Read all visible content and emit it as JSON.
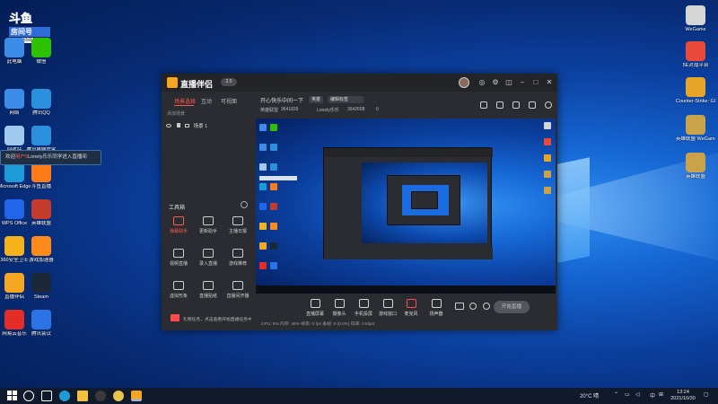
{
  "overlay": {
    "title": "斗鱼",
    "subtitle": "房间号",
    "room_no": "3642658"
  },
  "desktop_left": [
    {
      "label": "此电脑",
      "color": "#3b8de8"
    },
    {
      "label": "微信",
      "color": "#2dc100"
    },
    {
      "label": "网络",
      "color": "#3b8de8"
    },
    {
      "label": "腾讯QQ",
      "color": "#2a8fdd"
    },
    {
      "label": "回收站",
      "color": "#9fc9ef"
    },
    {
      "label": "腾讯电脑管家",
      "color": "#2a8fdd"
    },
    {
      "label": "Microsoft Edge",
      "color": "#1d9bd8"
    },
    {
      "label": "斗鱼直播",
      "color": "#ff7b17"
    },
    {
      "label": "WPS Office",
      "color": "#2165e8"
    },
    {
      "label": "英雄联盟",
      "color": "#c33b2b"
    },
    {
      "label": "360安全卫士",
      "color": "#f6b21a"
    },
    {
      "label": "游戏加速器",
      "color": "#ff8a1c"
    },
    {
      "label": "直播伴侣",
      "color": "#f5a623"
    },
    {
      "label": "Steam",
      "color": "#1b2838"
    },
    {
      "label": "网易云音乐",
      "color": "#e52d27"
    },
    {
      "label": "腾讯会议",
      "color": "#2b74e5"
    }
  ],
  "desktop_right": [
    {
      "label": "WeGame",
      "color": "#d5d5d5"
    },
    {
      "label": "5E对战平台",
      "color": "#e84b3c"
    },
    {
      "label": "Counter-Strike: Global Off...",
      "color": "#e7a527"
    },
    {
      "label": "英雄联盟 WeGame版",
      "color": "#c9a24a"
    },
    {
      "label": "英雄联盟",
      "color": "#c9a24a"
    }
  ],
  "toast": {
    "prefix": "欢迎",
    "highlight": "用户5",
    "rest": "Lonely乐乐同学进入直播间"
  },
  "app": {
    "logo": "直播伴侣",
    "version_badge": "2.0",
    "tabs": [
      "场景选择",
      "互动",
      "可视面"
    ],
    "scene_name": "场景 1",
    "add_scene": "添加场景",
    "stream_title": "开心快乐中间一下",
    "title_chip": "英雄",
    "cat_chip": "编辑标签",
    "sub_items": [
      "英雄联盟",
      "3641839",
      "Lonely乐乐",
      "3642658",
      "0"
    ],
    "toolbox_title": "工具箱",
    "tools": [
      {
        "label": "弹幕助手",
        "hot": true
      },
      {
        "label": "更新助手",
        "hot": false
      },
      {
        "label": "主播日报",
        "hot": false
      },
      {
        "label": "视频直播",
        "hot": false
      },
      {
        "label": "录入直播",
        "hot": false
      },
      {
        "label": "游戏推荐",
        "hot": false
      },
      {
        "label": "虚拟形象",
        "hot": false
      },
      {
        "label": "直播贴纸",
        "hot": false
      },
      {
        "label": "直播间开播",
        "hot": false
      }
    ],
    "left_status": "礼物任务，点击查看开始直播任务中，即将领取",
    "bottom_buttons": [
      {
        "label": "直播屏幕",
        "red": false
      },
      {
        "label": "摄像头",
        "red": false
      },
      {
        "label": "手机投屏",
        "red": false
      },
      {
        "label": "游戏窗口",
        "red": false
      },
      {
        "label": "麦克风",
        "red": true
      },
      {
        "label": "扬声器",
        "red": false
      }
    ],
    "go_live": "开始直播",
    "status_bar": "CPU: 5%  内存: 45%  帧率: 0 fps  丢帧: 0 (0.0%)  码率: 0 kbps"
  },
  "taskbar": {
    "temp": "20°C 晴",
    "lang": "中",
    "time": "13:24",
    "date": "2021/10/30"
  }
}
